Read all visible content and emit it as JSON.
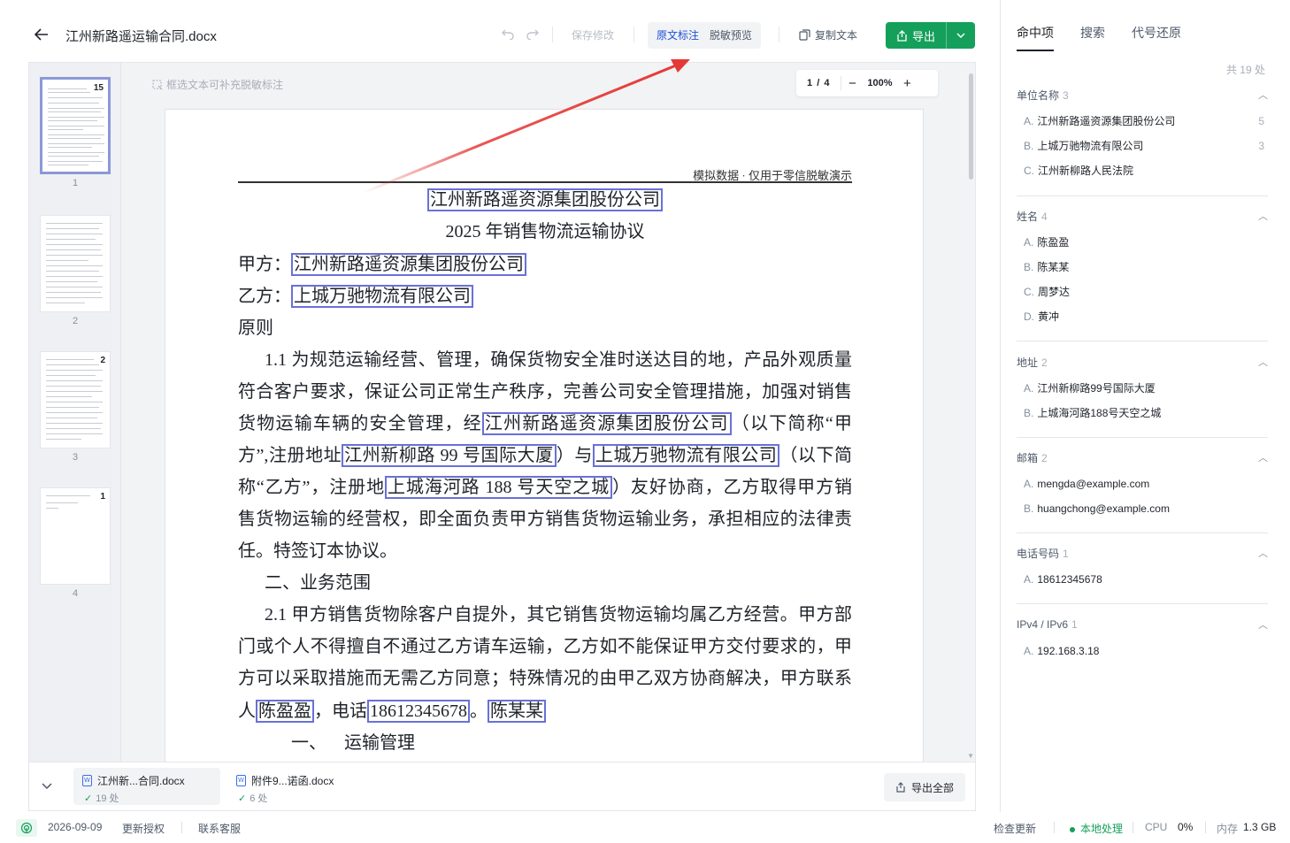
{
  "header": {
    "title": "江州新路遥运输合同.docx",
    "save_label": "保存修改",
    "mode_tabs": [
      "原文标注",
      "脱敏预览"
    ],
    "copy_label": "复制文本",
    "export_label": "导出"
  },
  "viewer": {
    "hint": "框选文本可补充脱敏标注",
    "page_current": "1",
    "page_sep": "/",
    "page_total": "4",
    "zoom": "100%"
  },
  "thumbnails": [
    {
      "num": "1",
      "badge": "15"
    },
    {
      "num": "2",
      "badge": ""
    },
    {
      "num": "3",
      "badge": "2"
    },
    {
      "num": "4",
      "badge": "1"
    }
  ],
  "document": {
    "header_note": "模拟数据 · 仅用于零信脱敏演示",
    "title1": "江州新路遥资源集团股份公司",
    "title2": "2025 年销售物流运输协议",
    "party_a_prefix": "甲方：",
    "party_a": "江州新路遥资源集团股份公司",
    "party_b_prefix": "乙方：",
    "party_b": "上城万驰物流有限公司",
    "principle": "原则",
    "p1_l1": "1.1 为规范运输经营、管理，确保货物安全准时送达目的地，产品外观质量",
    "p1_l2": "符合客户要求，保证公司正常生产秩序，完善公司安全管理措施，加强对销售",
    "p1_l3a": "货物运输车辆的安全管理，经",
    "p1_l3_hl": "江州新路遥资源集团股份公司",
    "p1_l3b": "（以下简称“甲",
    "p1_l4a": "方”,注册地址",
    "p1_l4_hl1": "江州新柳路 99 号国际大厦",
    "p1_l4b": "）与",
    "p1_l4_hl2": "上城万驰物流有限公司",
    "p1_l4c": "（以下简",
    "p1_l5a": "称“乙方”，注册地",
    "p1_l5_hl": "上城海河路 188 号天空之城",
    "p1_l5b": "）友好协商，乙方取得甲方销",
    "p1_l6": "售货物运输的经营权，即全面负责甲方销售货物运输业务，承担相应的法律责",
    "p1_l7": "任。特签订本协议。",
    "sec2": "二、业务范围",
    "p2_l1": "2.1 甲方销售货物除客户自提外，其它销售货物运输均属乙方经营。甲方部",
    "p2_l2": "门或个人不得擅自不通过乙方请车运输，乙方如不能保证甲方交付要求的，甲",
    "p2_l3": "方可以采取措施而无需乙方同意；特殊情况的由甲乙双方协商解决，甲方联系",
    "p2_l4a": "人",
    "p2_l4_hl1": "陈盈盈",
    "p2_l4b": "，电话",
    "p2_l4_hl2": "18612345678",
    "p2_l4c": "。",
    "p2_l4_hl3": "陈某某",
    "sec_transport": "一、    运输管理"
  },
  "files": [
    {
      "name": "江州新...合同.docx",
      "count": "19 处"
    },
    {
      "name": "附件9...诺函.docx",
      "count": "6 处"
    }
  ],
  "export_all_label": "导出全部",
  "panel": {
    "tabs": [
      "命中项",
      "搜索",
      "代号还原"
    ],
    "total": "共 19 处",
    "groups": [
      {
        "title": "单位名称",
        "count": "3",
        "items": [
          {
            "letter": "A.",
            "text": "江州新路遥资源集团股份公司",
            "n": "5"
          },
          {
            "letter": "B.",
            "text": "上城万驰物流有限公司",
            "n": "3"
          },
          {
            "letter": "C.",
            "text": "江州新柳路人民法院",
            "n": ""
          }
        ]
      },
      {
        "title": "姓名",
        "count": "4",
        "items": [
          {
            "letter": "A.",
            "text": "陈盈盈",
            "n": ""
          },
          {
            "letter": "B.",
            "text": "陈某某",
            "n": ""
          },
          {
            "letter": "C.",
            "text": "周梦达",
            "n": ""
          },
          {
            "letter": "D.",
            "text": "黄冲",
            "n": ""
          }
        ]
      },
      {
        "title": "地址",
        "count": "2",
        "items": [
          {
            "letter": "A.",
            "text": "江州新柳路99号国际大厦",
            "n": ""
          },
          {
            "letter": "B.",
            "text": "上城海河路188号天空之城",
            "n": ""
          }
        ]
      },
      {
        "title": "邮箱",
        "count": "2",
        "items": [
          {
            "letter": "A.",
            "text": "mengda@example.com",
            "n": ""
          },
          {
            "letter": "B.",
            "text": "huangchong@example.com",
            "n": ""
          }
        ]
      },
      {
        "title": "电话号码",
        "count": "1",
        "items": [
          {
            "letter": "A.",
            "text": "18612345678",
            "n": ""
          }
        ]
      },
      {
        "title": "IPv4 / IPv6",
        "count": "1",
        "items": [
          {
            "letter": "A.",
            "text": "192.168.3.18",
            "n": ""
          }
        ]
      }
    ]
  },
  "status": {
    "date": "2026-09-09",
    "renew": "更新授权",
    "support": "联系客服",
    "check_update": "检查更新",
    "local": "本地处理",
    "cpu_label": "CPU",
    "cpu_value": "0%",
    "mem_label": "内存",
    "mem_value": "1.3 GB"
  },
  "colors": {
    "accent_green": "#14a05a",
    "highlight_border": "#6871d8",
    "annotation_red": "#e53935"
  }
}
